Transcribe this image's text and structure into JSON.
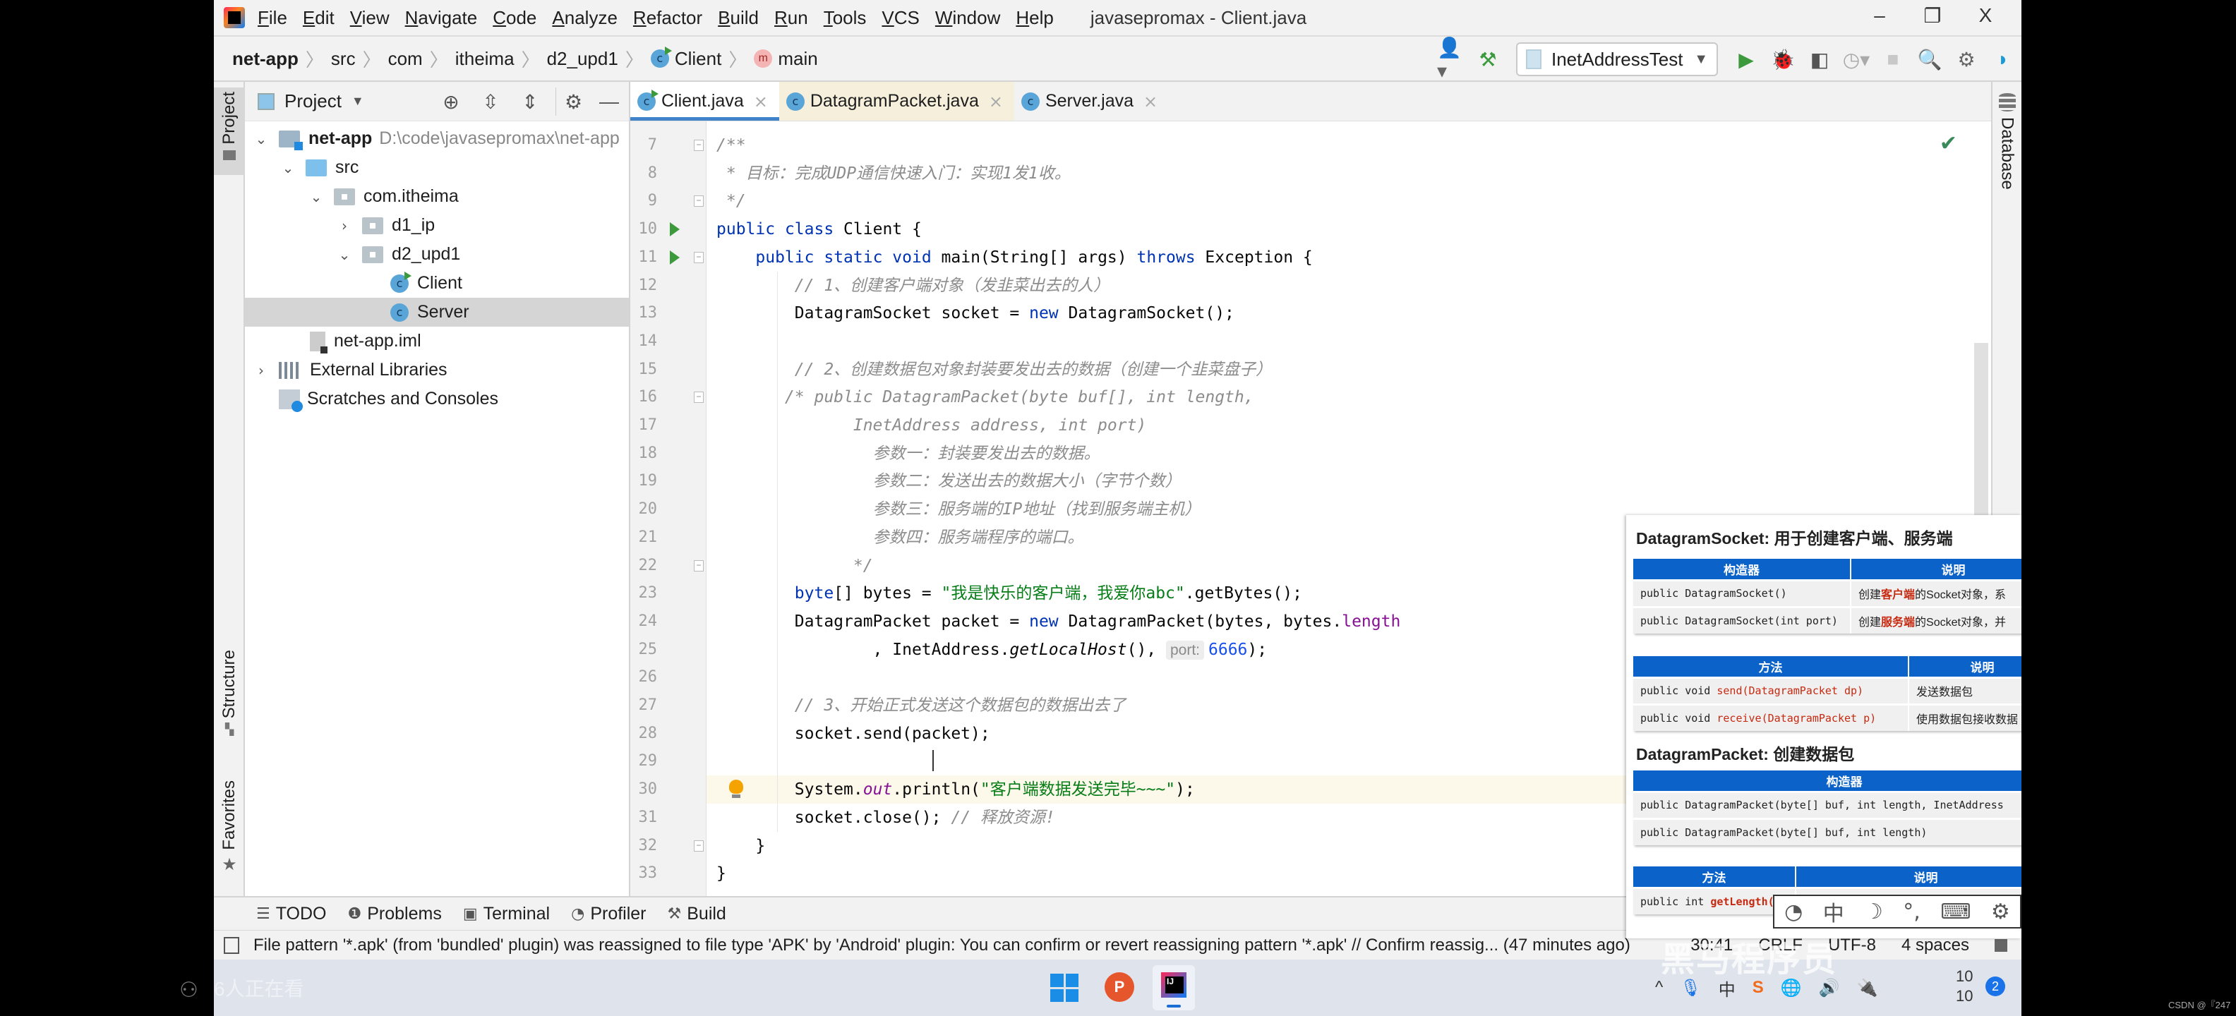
{
  "window": {
    "title": "javasepromax - Client.java",
    "controls": [
      "–",
      "❐",
      "X"
    ]
  },
  "menu": [
    "File",
    "Edit",
    "View",
    "Navigate",
    "Code",
    "Analyze",
    "Refactor",
    "Build",
    "Run",
    "Tools",
    "VCS",
    "Window",
    "Help"
  ],
  "breadcrumb": [
    "net-app",
    "src",
    "com",
    "itheima",
    "d2_upd1",
    "Client",
    "main"
  ],
  "toolbar": {
    "run_config": "InetAddressTest",
    "icons": [
      "user-icon",
      "build-hammer-icon",
      "run-icon",
      "debug-icon",
      "coverage-icon",
      "profile-icon",
      "stop-icon",
      "search-icon",
      "settings-icon",
      "toolbox-icon"
    ]
  },
  "left_strip": {
    "project": "Project",
    "structure": "Structure",
    "favorites": "Favorites"
  },
  "right_strip": {
    "database": "Database"
  },
  "project_panel": {
    "title": "Project",
    "tree": [
      {
        "label": "net-app",
        "extra": "D:\\code\\javasepromax\\net-app",
        "depth": 0,
        "state": "expanded",
        "icon": "module-folder"
      },
      {
        "label": "src",
        "depth": 1,
        "state": "expanded",
        "icon": "source-folder"
      },
      {
        "label": "com.itheima",
        "depth": 2,
        "state": "expanded",
        "icon": "package"
      },
      {
        "label": "d1_ip",
        "depth": 3,
        "state": "collapsed",
        "icon": "package"
      },
      {
        "label": "d2_upd1",
        "depth": 3,
        "state": "expanded",
        "icon": "package"
      },
      {
        "label": "Client",
        "depth": 4,
        "state": "leaf",
        "icon": "class-run"
      },
      {
        "label": "Server",
        "depth": 4,
        "state": "leaf",
        "icon": "class",
        "selected": true
      },
      {
        "label": "net-app.iml",
        "depth": 1,
        "state": "leaf",
        "icon": "iml-file"
      },
      {
        "label": "External Libraries",
        "depth": 0,
        "state": "collapsed",
        "icon": "libraries"
      },
      {
        "label": "Scratches and Consoles",
        "depth": 0,
        "state": "leaf",
        "icon": "scratches"
      }
    ]
  },
  "tabs": [
    {
      "label": "Client.java",
      "active": true
    },
    {
      "label": "DatagramPacket.java",
      "readonly": true
    },
    {
      "label": "Server.java"
    }
  ],
  "editor": {
    "current_line": 30,
    "lines": [
      {
        "n": 7,
        "text": "/**"
      },
      {
        "n": 8,
        "text": " * 目标：完成UDP通信快速入门：实现1发1收。"
      },
      {
        "n": 9,
        "text": " */"
      },
      {
        "n": 10,
        "text": "public class Client {"
      },
      {
        "n": 11,
        "text": "    public static void main(String[] args) throws Exception {"
      },
      {
        "n": 12,
        "text": "        // 1、创建客户端对象（发韭菜出去的人）"
      },
      {
        "n": 13,
        "text": "        DatagramSocket socket = new DatagramSocket();"
      },
      {
        "n": 14,
        "text": ""
      },
      {
        "n": 15,
        "text": "        // 2、创建数据包对象封装要发出去的数据（创建一个韭菜盘子）"
      },
      {
        "n": 16,
        "text": "       /* public DatagramPacket(byte buf[], int length,"
      },
      {
        "n": 17,
        "text": "              InetAddress address, int port)"
      },
      {
        "n": 18,
        "text": "                参数一：封装要发出去的数据。"
      },
      {
        "n": 19,
        "text": "                参数二：发送出去的数据大小（字节个数）"
      },
      {
        "n": 20,
        "text": "                参数三：服务端的IP地址（找到服务端主机）"
      },
      {
        "n": 21,
        "text": "                参数四：服务端程序的端口。"
      },
      {
        "n": 22,
        "text": "              */"
      },
      {
        "n": 23,
        "text": "        byte[] bytes = \"我是快乐的客户端，我爱你abc\".getBytes();"
      },
      {
        "n": 24,
        "text": "        DatagramPacket packet = new DatagramPacket(bytes, bytes.length"
      },
      {
        "n": 25,
        "text": "                , InetAddress.getLocalHost(), port: 6666);"
      },
      {
        "n": 26,
        "text": ""
      },
      {
        "n": 27,
        "text": "        // 3、开始正式发送这个数据包的数据出去了"
      },
      {
        "n": 28,
        "text": "        socket.send(packet);"
      },
      {
        "n": 29,
        "text": ""
      },
      {
        "n": 30,
        "text": "        System.out.println(\"客户端数据发送完毕~~~\");"
      },
      {
        "n": 31,
        "text": "        socket.close(); // 释放资源!"
      },
      {
        "n": 32,
        "text": "    }"
      },
      {
        "n": 33,
        "text": "}"
      }
    ],
    "param_hint": "port:",
    "port_value": "6666"
  },
  "tool_windows": [
    "TODO",
    "Problems",
    "Terminal",
    "Profiler",
    "Build"
  ],
  "status": {
    "message": "File pattern '*.apk' (from 'bundled' plugin) was reassigned to file type 'APK' by 'Android' plugin: You can confirm or revert reassigning pattern '*.apk' // Confirm reassig... (47 minutes ago)",
    "position": "30:41",
    "line_sep": "CRLF",
    "encoding": "UTF-8",
    "indent": "4 spaces"
  },
  "overlay": {
    "socket_title": "DatagramSocket: 用于创建客户端、服务端",
    "socket_ctor_headers": [
      "构造器",
      "说明"
    ],
    "socket_ctors": [
      {
        "sig": "public DatagramSocket()",
        "desc_pre": "创建",
        "desc_hl": "客户端",
        "desc_post": "的Socket对象，系"
      },
      {
        "sig": "public DatagramSocket(int port)",
        "desc_pre": "创建",
        "desc_hl": "服务端",
        "desc_post": "的Socket对象，并"
      }
    ],
    "socket_method_headers": [
      "方法",
      "说明"
    ],
    "socket_methods": [
      {
        "pre": "public void ",
        "hl": "send(DatagramPacket dp)",
        "desc": "发送数据包"
      },
      {
        "pre": "public void ",
        "hl": "receive(DatagramPacket p)",
        "desc": "使用数据包接收数据"
      }
    ],
    "packet_title": "DatagramPacket: 创建数据包",
    "packet_ctor_header": "构造器",
    "packet_ctors": [
      "public DatagramPacket(byte[] buf, int length, InetAddress",
      "public DatagramPacket(byte[] buf, int length)"
    ],
    "packet_method_headers": [
      "方法",
      "说明"
    ],
    "packet_methods": [
      {
        "pre": "public int ",
        "hl": "getLength()"
      }
    ]
  },
  "ime_bar": [
    "◔",
    "中",
    "☽",
    "°,",
    "⌨",
    "⚙"
  ],
  "taskbar": {
    "viewers": "6人正在看",
    "tray": [
      "^",
      "🎙",
      "中",
      "S",
      "🌐",
      "🔊",
      "🔌"
    ],
    "clock_top": "10",
    "clock_bottom": "10",
    "notifications": "2"
  },
  "watermark": "黑马程序员",
  "corner_credit": "CSDN @『247"
}
